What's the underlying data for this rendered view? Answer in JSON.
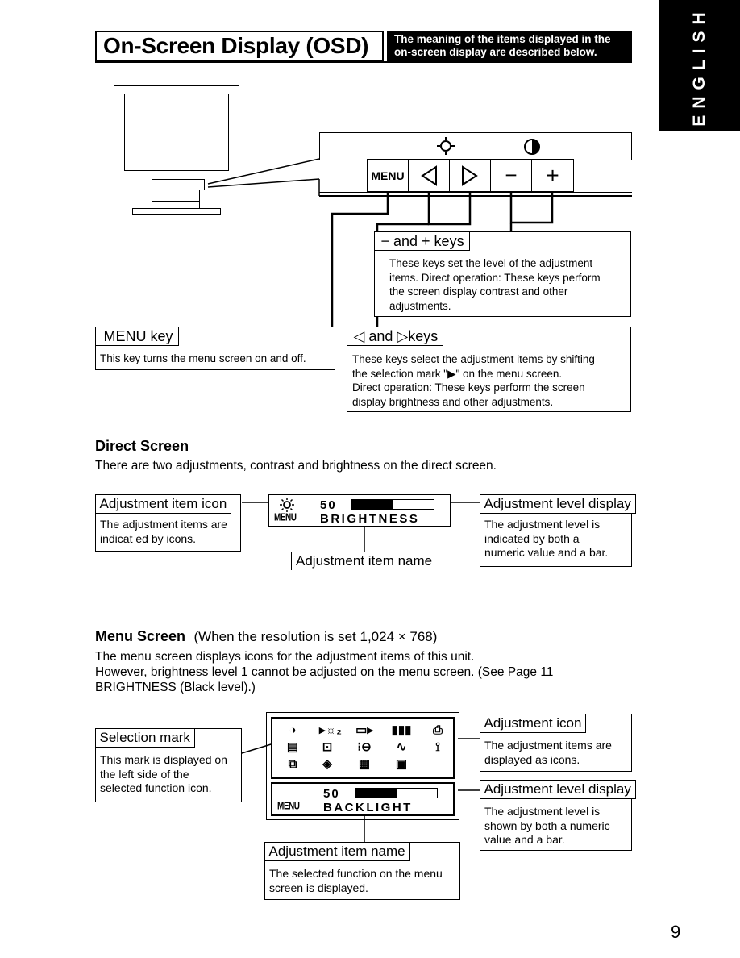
{
  "header": {
    "title": "On-Screen Display (OSD)",
    "description_line1": "The meaning of the items displayed in the",
    "description_line2": "on-screen display are described below."
  },
  "language_tab": "ENGLISH",
  "keypad": {
    "top_icons": [
      "brightness-sun-icon",
      "contrast-half-circle-icon"
    ],
    "keys": [
      {
        "name": "menu",
        "label": "MENU"
      },
      {
        "name": "left",
        "label": "◁"
      },
      {
        "name": "right",
        "label": "▷"
      },
      {
        "name": "minus",
        "label": "−"
      },
      {
        "name": "plus",
        "label": "+"
      }
    ]
  },
  "callouts": {
    "minus_plus": {
      "title": "− and + keys",
      "lines": [
        "These keys set the level of the adjustment",
        "items. Direct operation: These keys perform",
        "the screen display contrast and other",
        "adjustments."
      ]
    },
    "menu_key": {
      "title": "MENU key",
      "lines": [
        "This key turns the menu screen on and off."
      ]
    },
    "left_right": {
      "title": "◁  and ▷keys",
      "lines": [
        "These keys select the adjustment items by shifting",
        "the selection mark \"▶\" on the menu screen.",
        "Direct operation: These keys perform the screen",
        "display brightness and other adjustments."
      ]
    }
  },
  "direct_screen": {
    "title": "Direct Screen",
    "text": "There are two adjustments, contrast and brightness on the direct screen.",
    "osd": {
      "value": "50",
      "level_percent": 50,
      "item_name": "BRIGHTNESS",
      "menu_label": "MENU",
      "icon": "brightness-sun-icon"
    },
    "item_icon": {
      "title": "Adjustment item icon",
      "lines": [
        "The adjustment items are",
        "indicat ed by icons."
      ]
    },
    "item_name": {
      "title": "Adjustment item name"
    },
    "level_display": {
      "title": "Adjustment level display",
      "lines": [
        "The adjustment level is",
        "indicated by both a",
        "numeric value and a bar."
      ]
    }
  },
  "menu_screen": {
    "title": "Menu Screen",
    "subtitle": "(When the resolution is set 1,024 × 768)",
    "text_lines": [
      "The menu screen displays icons for the adjustment items of this unit.",
      "However, brightness level 1 cannot be adjusted on the menu screen. (See Page 11",
      "BRIGHTNESS (Black level).)"
    ],
    "osd": {
      "icons": [
        "◑",
        "▸☼₂",
        "▭▸",
        "▮▮▮",
        "⎙",
        "▤",
        "⊡",
        "⁝⊖",
        "∿",
        "⟟",
        "⧉",
        "◈",
        "▦",
        "▣"
      ],
      "value": "50",
      "level_percent": 50,
      "item_name": "BACKLIGHT",
      "menu_label": "MENU"
    },
    "selection_mark": {
      "title": "Selection mark",
      "lines": [
        "This mark is displayed on",
        "the left side of the",
        "selected function icon."
      ]
    },
    "adjustment_icon": {
      "title": "Adjustment icon",
      "lines": [
        "The adjustment items are",
        "displayed as icons."
      ]
    },
    "level_display": {
      "title": "Adjustment level display",
      "lines": [
        "The adjustment level is",
        "shown by both a numeric",
        "value and a bar."
      ]
    },
    "item_name": {
      "title": "Adjustment item name",
      "lines": [
        "The selected function on the menu",
        "screen is displayed."
      ]
    }
  },
  "page_number": "9"
}
